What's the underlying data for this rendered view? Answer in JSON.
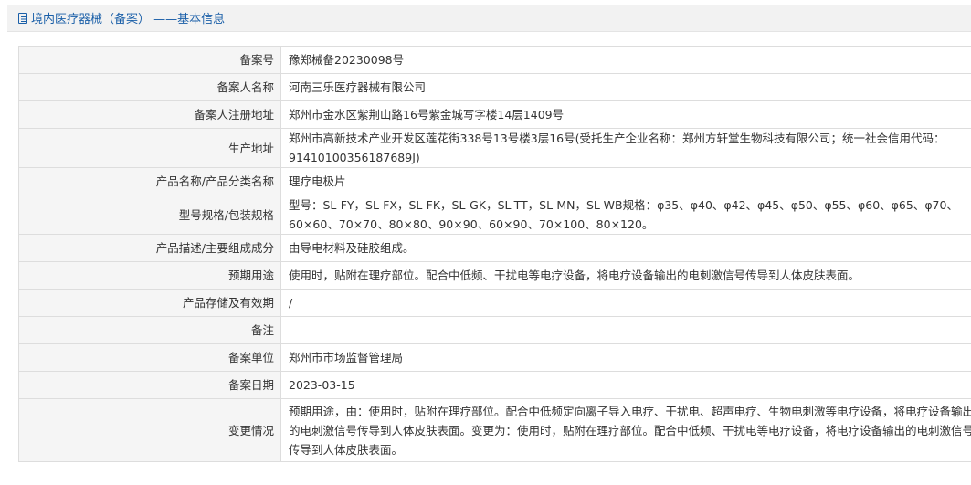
{
  "header": {
    "icon": "document-icon",
    "title": "境内医疗器械（备案） ——基本信息"
  },
  "rows": [
    {
      "label": "备案号",
      "value": "豫郑械备20230098号"
    },
    {
      "label": "备案人名称",
      "value": "河南三乐医疗器械有限公司"
    },
    {
      "label": "备案人注册地址",
      "value": "郑州市金水区紫荆山路16号紫金城写字楼14层1409号"
    },
    {
      "label": "生产地址",
      "value": "郑州市高新技术产业开发区莲花街338号13号楼3层16号(受托生产企业名称：郑州方轩堂生物科技有限公司；统一社会信用代码：91410100356187689J)"
    },
    {
      "label": "产品名称/产品分类名称",
      "value": "理疗电极片"
    },
    {
      "label": "型号规格/包装规格",
      "value": "型号：SL-FY，SL-FX，SL-FK，SL-GK，SL-TT，SL-MN，SL-WB规格：φ35、φ40、φ42、φ45、φ50、φ55、φ60、φ65、φ70、60×60、70×70、80×80、90×90、60×90、70×100、80×120。"
    },
    {
      "label": "产品描述/主要组成成分",
      "value": "由导电材料及硅胶组成。"
    },
    {
      "label": "预期用途",
      "value": "使用时，贴附在理疗部位。配合中低频、干扰电等电疗设备，将电疗设备输出的电刺激信号传导到人体皮肤表面。"
    },
    {
      "label": "产品存储及有效期",
      "value": "/"
    },
    {
      "label": "备注",
      "value": ""
    },
    {
      "label": "备案单位",
      "value": "郑州市市场监督管理局"
    },
    {
      "label": "备案日期",
      "value": "2023-03-15"
    },
    {
      "label": "变更情况",
      "value": "预期用途，由：使用时，贴附在理疗部位。配合中低频定向离子导入电疗、干扰电、超声电疗、生物电刺激等电疗设备，将电疗设备输出的电刺激信号传导到人体皮肤表面。变更为：使用时，贴附在理疗部位。配合中低频、干扰电等电疗设备，将电疗设备输出的电刺激信号传导到人体皮肤表面。"
    }
  ]
}
